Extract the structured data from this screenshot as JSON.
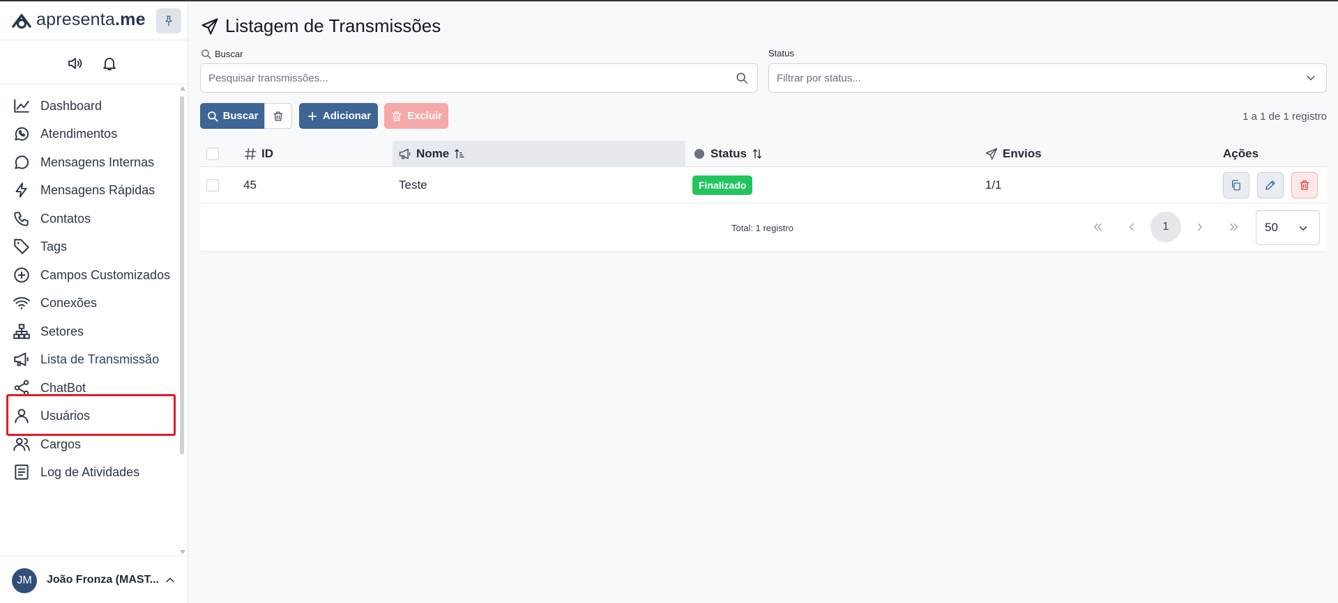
{
  "brand": {
    "name_prefix": "apresenta",
    "name_suffix": ".me"
  },
  "sidebar": {
    "items": [
      {
        "label": "Dashboard",
        "icon": "chart-line-icon"
      },
      {
        "label": "Atendimentos",
        "icon": "whatsapp-icon"
      },
      {
        "label": "Mensagens Internas",
        "icon": "chat-bubble-icon"
      },
      {
        "label": "Mensagens Rápidas",
        "icon": "lightning-icon"
      },
      {
        "label": "Contatos",
        "icon": "phone-icon"
      },
      {
        "label": "Tags",
        "icon": "tag-icon"
      },
      {
        "label": "Campos Customizados",
        "icon": "plus-circle-icon"
      },
      {
        "label": "Conexões",
        "icon": "wifi-icon"
      },
      {
        "label": "Setores",
        "icon": "sitemap-icon"
      },
      {
        "label": "Lista de Transmissão",
        "icon": "megaphone-icon",
        "active": true
      },
      {
        "label": "ChatBot",
        "icon": "share-icon"
      },
      {
        "label": "Usuários",
        "icon": "user-icon"
      },
      {
        "label": "Cargos",
        "icon": "users-icon"
      },
      {
        "label": "Log de Atividades",
        "icon": "list-icon"
      }
    ],
    "user": {
      "initials": "JM",
      "name": "João Fronza (MAST..."
    }
  },
  "page": {
    "title": "Listagem de Transmissões"
  },
  "filters": {
    "search_label": "Buscar",
    "search_placeholder": "Pesquisar transmissões...",
    "status_label": "Status",
    "status_placeholder": "Filtrar por status..."
  },
  "toolbar": {
    "search_button": "Buscar",
    "add_button": "Adicionar",
    "delete_button": "Excluir",
    "range_text": "1 a 1 de 1 registro"
  },
  "table": {
    "columns": {
      "id": "ID",
      "name": "Nome",
      "status": "Status",
      "sends": "Envios",
      "actions": "Ações"
    },
    "rows": [
      {
        "id": "45",
        "name": "Teste",
        "status": "Finalizado",
        "sends": "1/1"
      }
    ]
  },
  "pagination": {
    "total_text": "Total: 1 registro",
    "current_page": "1",
    "page_size": "50"
  },
  "colors": {
    "primary": "#3d6596",
    "success": "#22c55e",
    "danger": "#e53e3e",
    "highlight": "#e31b23"
  }
}
